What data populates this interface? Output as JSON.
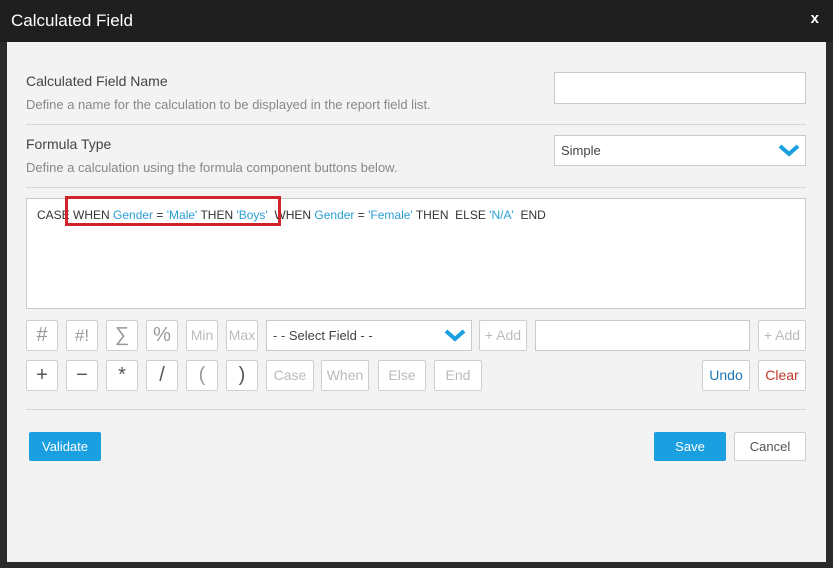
{
  "dialog": {
    "title": "Calculated Field",
    "close_label": "x"
  },
  "name_section": {
    "label": "Calculated Field Name",
    "description": "Define a name for the calculation to be displayed in the report field list.",
    "value": ""
  },
  "formula_type": {
    "label": "Formula Type",
    "description": "Define a calculation using the formula component buttons below.",
    "selected": "Simple"
  },
  "formula": {
    "tokens": [
      {
        "t": "CASE ",
        "k": "kw"
      },
      {
        "t": "WHEN ",
        "k": "kw"
      },
      {
        "t": "Gender",
        "k": "fld"
      },
      {
        "t": " = ",
        "k": "kw"
      },
      {
        "t": "'Male'",
        "k": "str"
      },
      {
        "t": " THEN ",
        "k": "kw"
      },
      {
        "t": "'Boys'",
        "k": "str"
      },
      {
        "t": "  WHEN ",
        "k": "kw"
      },
      {
        "t": "Gender",
        "k": "fld"
      },
      {
        "t": " = ",
        "k": "kw"
      },
      {
        "t": "'Female'",
        "k": "str"
      },
      {
        "t": " THEN  ELSE ",
        "k": "kw"
      },
      {
        "t": "'N/A'",
        "k": "str"
      },
      {
        "t": "  END",
        "k": "kw"
      }
    ]
  },
  "toolbar_row1": {
    "hash": "#",
    "hash_bang": "#!",
    "sigma": "∑",
    "percent": "%",
    "min": "Min",
    "max": "Max",
    "select_field": "- - Select Field - -",
    "add1": "+ Add",
    "text_value": "",
    "add2": "+ Add"
  },
  "toolbar_row2": {
    "plus": "+",
    "minus": "−",
    "multiply": "*",
    "divide": "/",
    "open_paren": "(",
    "close_paren": ")",
    "case": "Case",
    "when": "When",
    "else": "Else",
    "end": "End",
    "undo": "Undo",
    "clear": "Clear"
  },
  "footer": {
    "validate": "Validate",
    "save": "Save",
    "cancel": "Cancel"
  },
  "colors": {
    "accent": "#1a9fe0",
    "highlight": "#d2232a",
    "field_token": "#2a9fd6"
  }
}
